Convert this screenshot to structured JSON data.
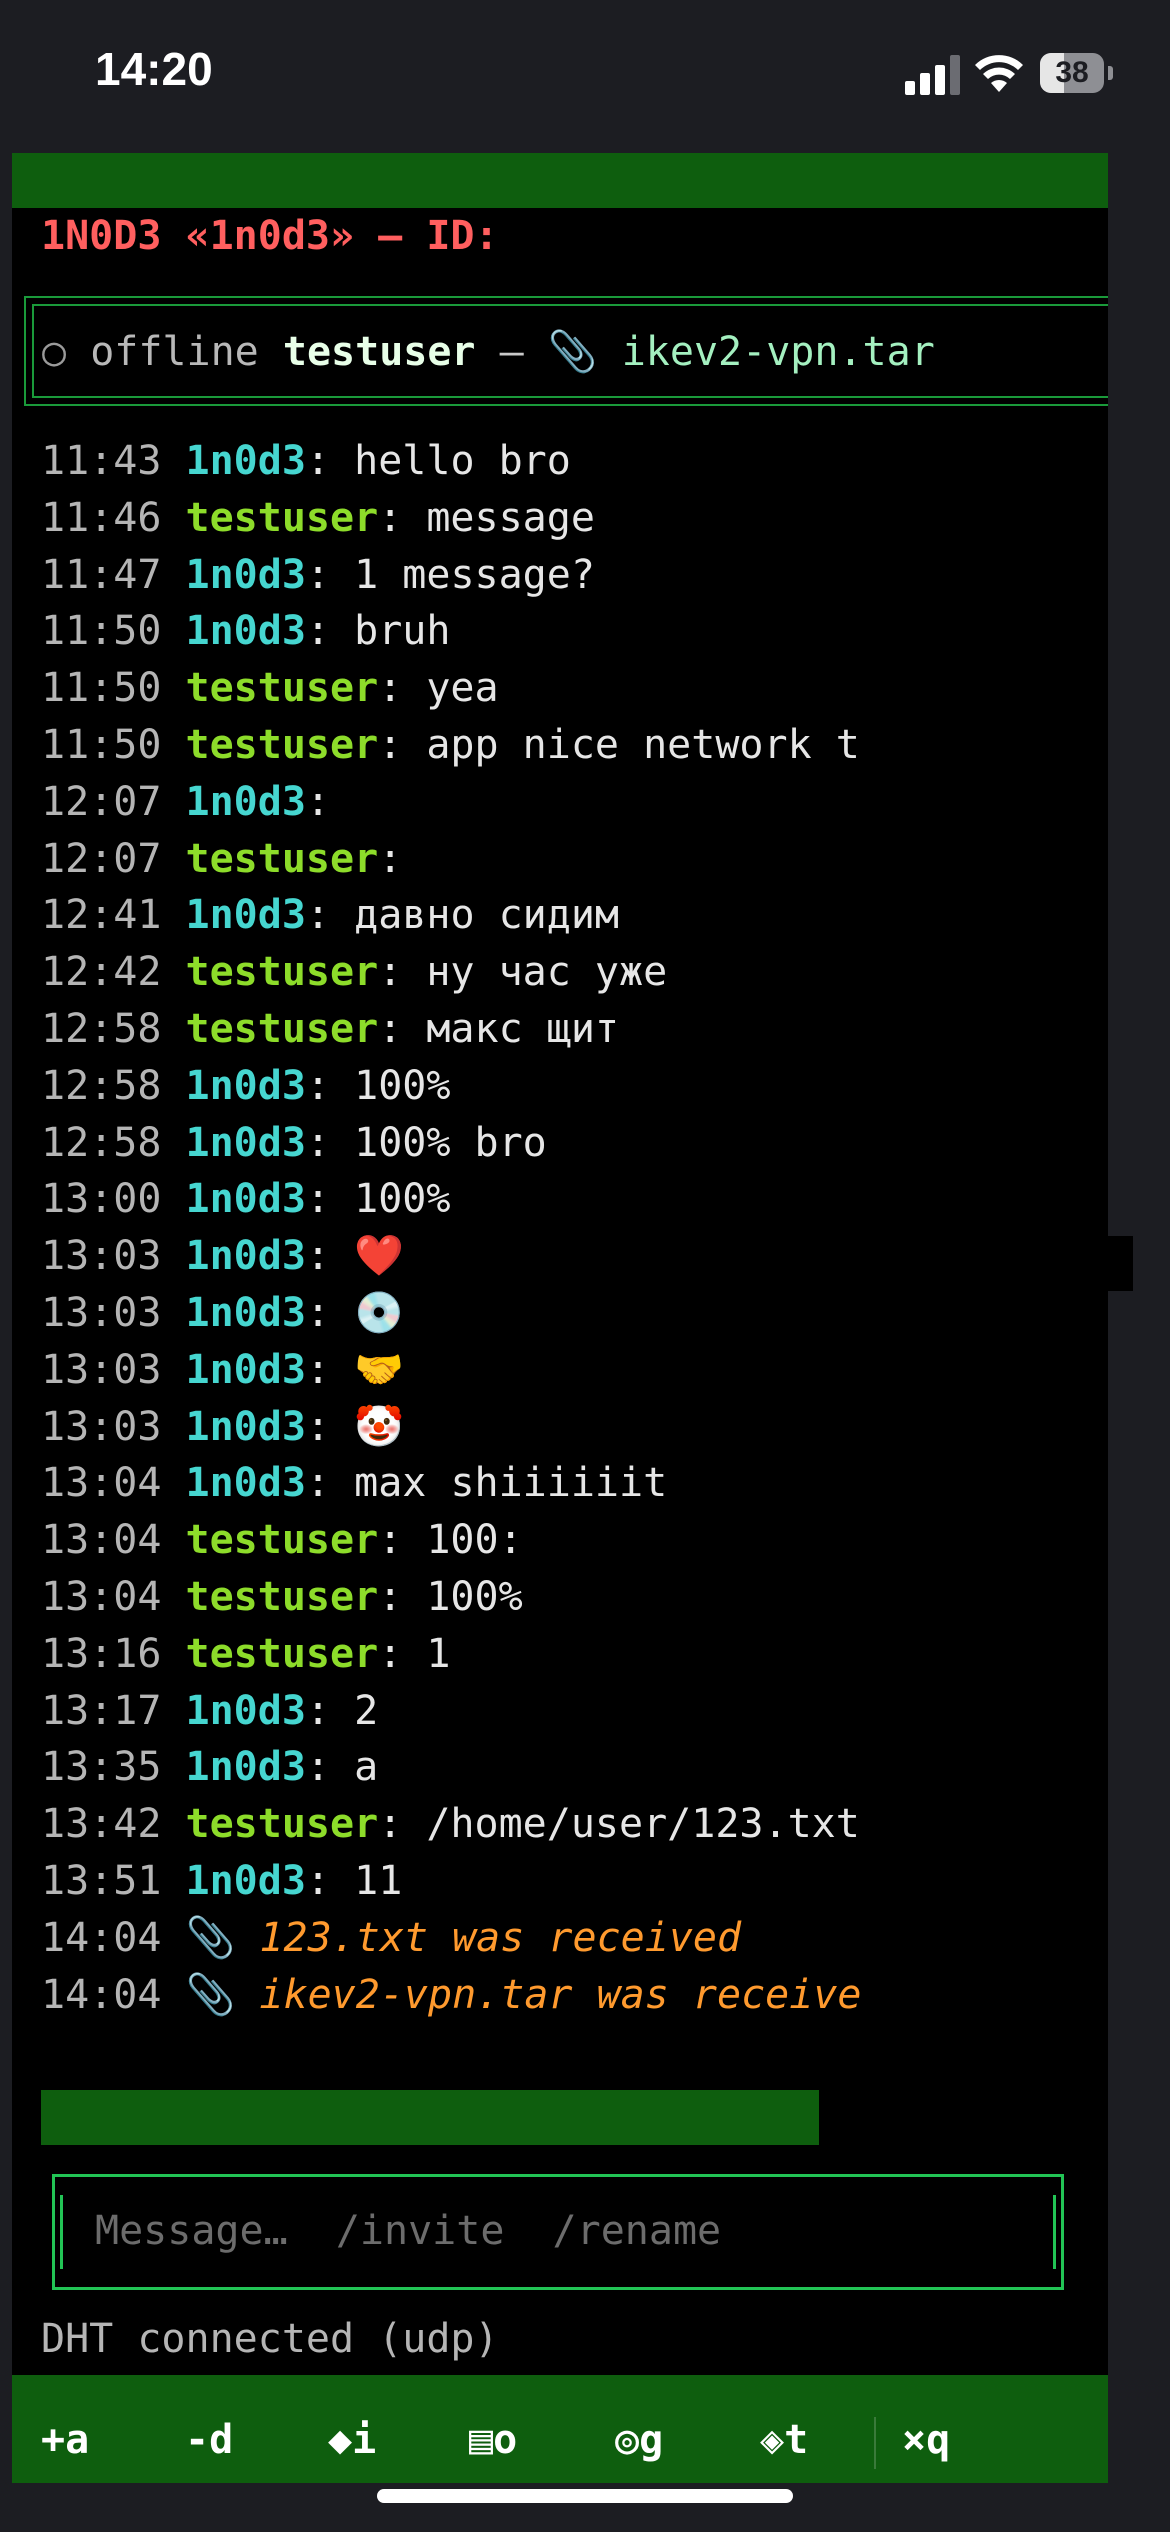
{
  "status_bar": {
    "time": "14:20",
    "battery": "38",
    "battery_fraction": 0.38
  },
  "header": {
    "title": "1N0D3 «1n0d3» — ID:"
  },
  "peer": {
    "status_symbol": "○",
    "status": "offline",
    "name": "testuser",
    "separator": "—",
    "file_icon": "paperclip-icon",
    "file_icon_glyph": "📎",
    "file": "ikev2-vpn.tar"
  },
  "messages": [
    {
      "time": "11:43",
      "nick": "1n0d3",
      "self": true,
      "text": "hello bro"
    },
    {
      "time": "11:46",
      "nick": "testuser",
      "self": false,
      "text": "message"
    },
    {
      "time": "11:47",
      "nick": "1n0d3",
      "self": true,
      "text": "1 message?"
    },
    {
      "time": "11:50",
      "nick": "1n0d3",
      "self": true,
      "text": "bruh"
    },
    {
      "time": "11:50",
      "nick": "testuser",
      "self": false,
      "text": "yea"
    },
    {
      "time": "11:50",
      "nick": "testuser",
      "self": false,
      "text": "app nice network t"
    },
    {
      "time": "12:07",
      "nick": "1n0d3",
      "self": true,
      "text": ""
    },
    {
      "time": "12:07",
      "nick": "testuser",
      "self": false,
      "text": ""
    },
    {
      "time": "12:41",
      "nick": "1n0d3",
      "self": true,
      "text": "давно сидим"
    },
    {
      "time": "12:42",
      "nick": "testuser",
      "self": false,
      "text": "ну час уже"
    },
    {
      "time": "12:58",
      "nick": "testuser",
      "self": false,
      "text": "макс щит"
    },
    {
      "time": "12:58",
      "nick": "1n0d3",
      "self": true,
      "text": "100%"
    },
    {
      "time": "12:58",
      "nick": "1n0d3",
      "self": true,
      "text": "100% bro"
    },
    {
      "time": "13:00",
      "nick": "1n0d3",
      "self": true,
      "text": "100%"
    },
    {
      "time": "13:03",
      "nick": "1n0d3",
      "self": true,
      "text": "❤️"
    },
    {
      "time": "13:03",
      "nick": "1n0d3",
      "self": true,
      "text": "💿"
    },
    {
      "time": "13:03",
      "nick": "1n0d3",
      "self": true,
      "text": "🤝"
    },
    {
      "time": "13:03",
      "nick": "1n0d3",
      "self": true,
      "text": "🤡"
    },
    {
      "time": "13:04",
      "nick": "1n0d3",
      "self": true,
      "text": "max shiiiiiit"
    },
    {
      "time": "13:04",
      "nick": "testuser",
      "self": false,
      "text": "100:"
    },
    {
      "time": "13:04",
      "nick": "testuser",
      "self": false,
      "text": "100%"
    },
    {
      "time": "13:16",
      "nick": "testuser",
      "self": false,
      "text": "1"
    },
    {
      "time": "13:17",
      "nick": "1n0d3",
      "self": true,
      "text": "2"
    },
    {
      "time": "13:35",
      "nick": "1n0d3",
      "self": true,
      "text": "a"
    },
    {
      "time": "13:42",
      "nick": "testuser",
      "self": false,
      "text": "/home/user/123.txt"
    },
    {
      "time": "13:51",
      "nick": "1n0d3",
      "self": true,
      "text": "11"
    },
    {
      "time": "14:04",
      "system": true,
      "icon": "📎",
      "text": "123.txt was received"
    },
    {
      "time": "14:04",
      "system": true,
      "icon": "📎",
      "text": "ikev2-vpn.tar was receive"
    }
  ],
  "progress": {
    "fraction": 0.7
  },
  "input": {
    "placeholder": "Message…  /invite  /rename",
    "value": ""
  },
  "network_status": "DHT connected (udp)",
  "bottom_bar": {
    "items": [
      {
        "label": "+a",
        "name": "add-command"
      },
      {
        "label": "-d",
        "name": "delete-command"
      },
      {
        "label": "◆i",
        "name": "info-command"
      },
      {
        "label": "▤o",
        "name": "open-command"
      },
      {
        "label": "◎g",
        "name": "group-command"
      },
      {
        "label": "◈t",
        "name": "transfer-command"
      },
      {
        "label": "×q",
        "name": "quit-command"
      }
    ]
  },
  "colors": {
    "bar_green": "#0e5e0e",
    "border_green": "#22c455",
    "self_nick": "#46d6d0",
    "peer_nick": "#8ddc2a",
    "system_text": "#ff9a2e",
    "header_red": "#ff5f5f"
  }
}
